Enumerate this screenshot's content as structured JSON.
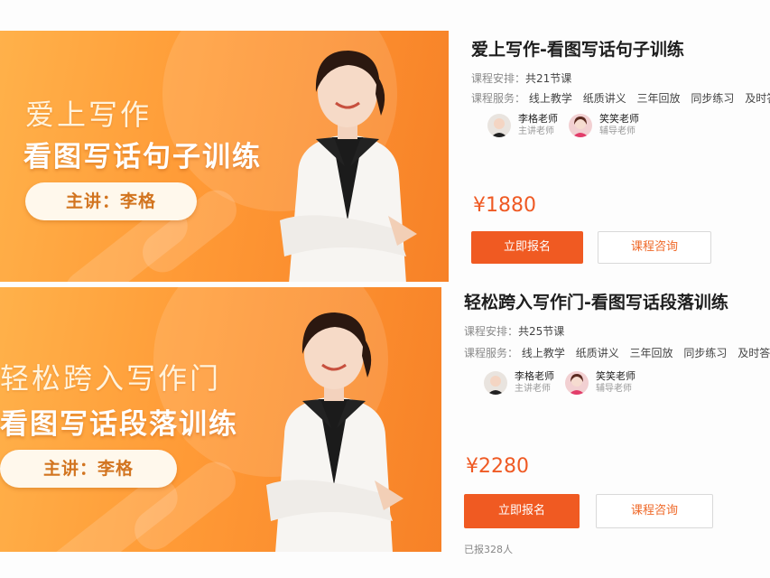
{
  "courses": [
    {
      "banner": {
        "line1": "爱上写作",
        "line2": "看图写话句子训练",
        "pill": "主讲：李格"
      },
      "title": "爱上写作-看图写话句子训练",
      "schedule_label": "课程安排：",
      "schedule_value": "共21节课",
      "service_label": "课程服务：",
      "services": [
        "线上教学",
        "纸质讲义",
        "三年回放",
        "同步练习",
        "及时答疑"
      ],
      "teachers": [
        {
          "name": "李格老师",
          "role": "主讲老师"
        },
        {
          "name": "笑笑老师",
          "role": "辅导老师"
        }
      ],
      "price": "¥1880",
      "enroll_label": "立即报名",
      "consult_label": "课程咨询"
    },
    {
      "banner": {
        "line1": "轻松跨入写作门",
        "line2": "看图写话段落训练",
        "pill": "主讲：李格"
      },
      "title": "轻松跨入写作门-看图写话段落训练",
      "schedule_label": "课程安排：",
      "schedule_value": "共25节课",
      "service_label": "课程服务：",
      "services": [
        "线上教学",
        "纸质讲义",
        "三年回放",
        "同步练习",
        "及时答疑"
      ],
      "teachers": [
        {
          "name": "李格老师",
          "role": "主讲老师"
        },
        {
          "name": "笑笑老师",
          "role": "辅导老师"
        }
      ],
      "price": "¥2280",
      "enroll_label": "立即报名",
      "consult_label": "课程咨询",
      "enrolled": "已报328人"
    }
  ],
  "colors": {
    "accent": "#f05a22",
    "price": "#ef5a24",
    "banner_start": "#ffb14a",
    "banner_end": "#f78127"
  }
}
